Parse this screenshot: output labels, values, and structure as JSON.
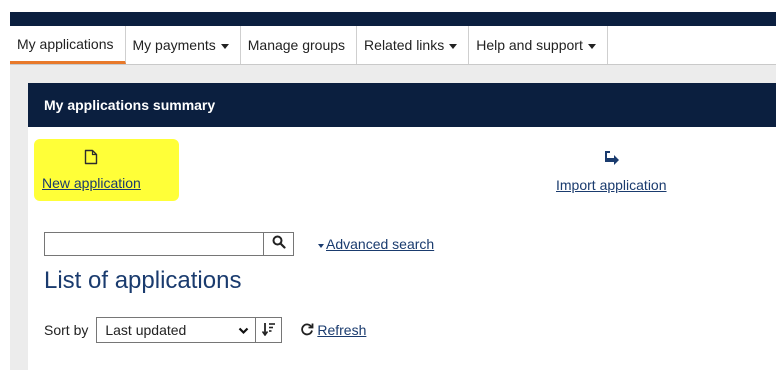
{
  "nav": {
    "items": [
      {
        "label": "My applications",
        "active": true,
        "has_caret": false
      },
      {
        "label": "My payments",
        "active": false,
        "has_caret": true
      },
      {
        "label": "Manage groups",
        "active": false,
        "has_caret": false
      },
      {
        "label": "Related links",
        "active": false,
        "has_caret": true
      },
      {
        "label": "Help and support",
        "active": false,
        "has_caret": true
      }
    ]
  },
  "panel": {
    "title": "My applications summary",
    "new_application": {
      "label": "New application",
      "icon": "document-icon"
    },
    "import_application": {
      "label": "Import application",
      "icon": "reply-arrow-icon"
    }
  },
  "search": {
    "value": "",
    "placeholder": "",
    "button_icon": "search-icon",
    "advanced_label": "Advanced search"
  },
  "list": {
    "title": "List of applications",
    "sort_label": "Sort by",
    "sort_selected": "Last updated",
    "sort_direction_icon": "sort-descending-icon",
    "refresh_label": "Refresh",
    "refresh_icon": "refresh-icon"
  },
  "colors": {
    "navy": "#0b1f3f",
    "accent_orange": "#e8792a",
    "highlight_yellow": "#ffff38",
    "link_blue": "#1a3b6e",
    "page_gray": "#ececec"
  }
}
